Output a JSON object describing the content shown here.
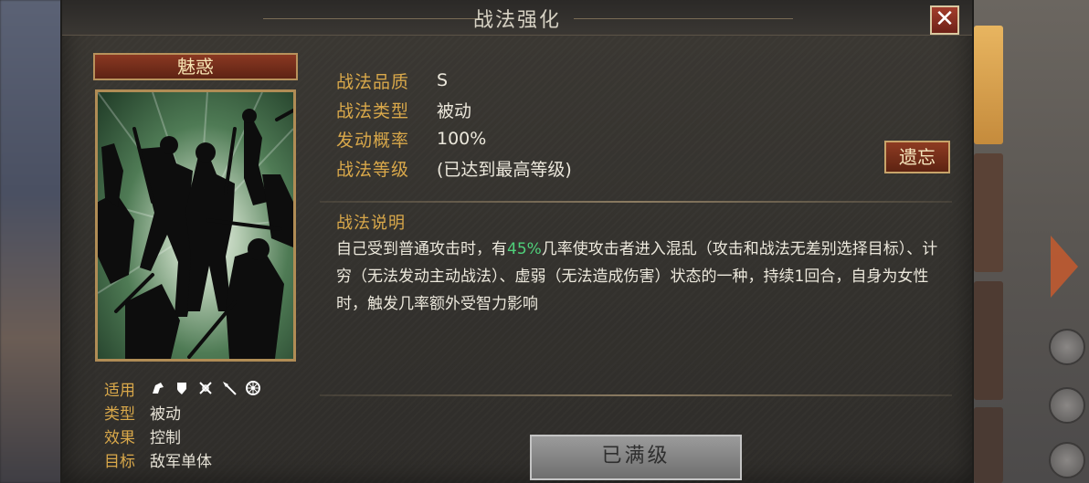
{
  "dialog": {
    "title": "战法强化",
    "close_icon": "close-icon"
  },
  "skill": {
    "name": "魅惑"
  },
  "attributes": [
    {
      "key": "战法品质",
      "value": "S"
    },
    {
      "key": "战法类型",
      "value": "被动"
    },
    {
      "key": "发动概率",
      "value": "100%"
    },
    {
      "key": "战法等级",
      "value": "(已达到最高等级)"
    }
  ],
  "forget_button": "遗忘",
  "description": {
    "title": "战法说明",
    "text_before": "自己受到普通攻击时，有",
    "highlight": "45%",
    "text_after": "几率使攻击者进入混乱（攻击和战法无差别选择目标）、计穷（无法发动主动战法）、虚弱（无法造成伤害）状态的一种，持续1回合，自身为女性时，触发几率额外受智力影响"
  },
  "meta": {
    "applicable_label": "适用",
    "applicable_icons": [
      "cavalry-icon",
      "shield-icon",
      "bow-icon",
      "spear-icon",
      "siege-icon"
    ],
    "type_label": "类型",
    "type_value": "被动",
    "effect_label": "效果",
    "effect_value": "控制",
    "target_label": "目标",
    "target_value": "敌军单体"
  },
  "max_level_button": "已满级",
  "colors": {
    "label_gold": "#d9a84a",
    "highlight_green": "#4fd07a",
    "button_red": "#8e3b22"
  }
}
